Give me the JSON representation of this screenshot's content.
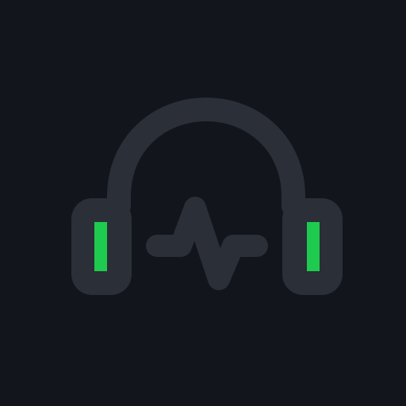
{
  "icon": {
    "name": "headphones-pulse-icon",
    "colors": {
      "background": "#12151b",
      "body": "#2a2f38",
      "accent": "#1fcb4f"
    }
  }
}
